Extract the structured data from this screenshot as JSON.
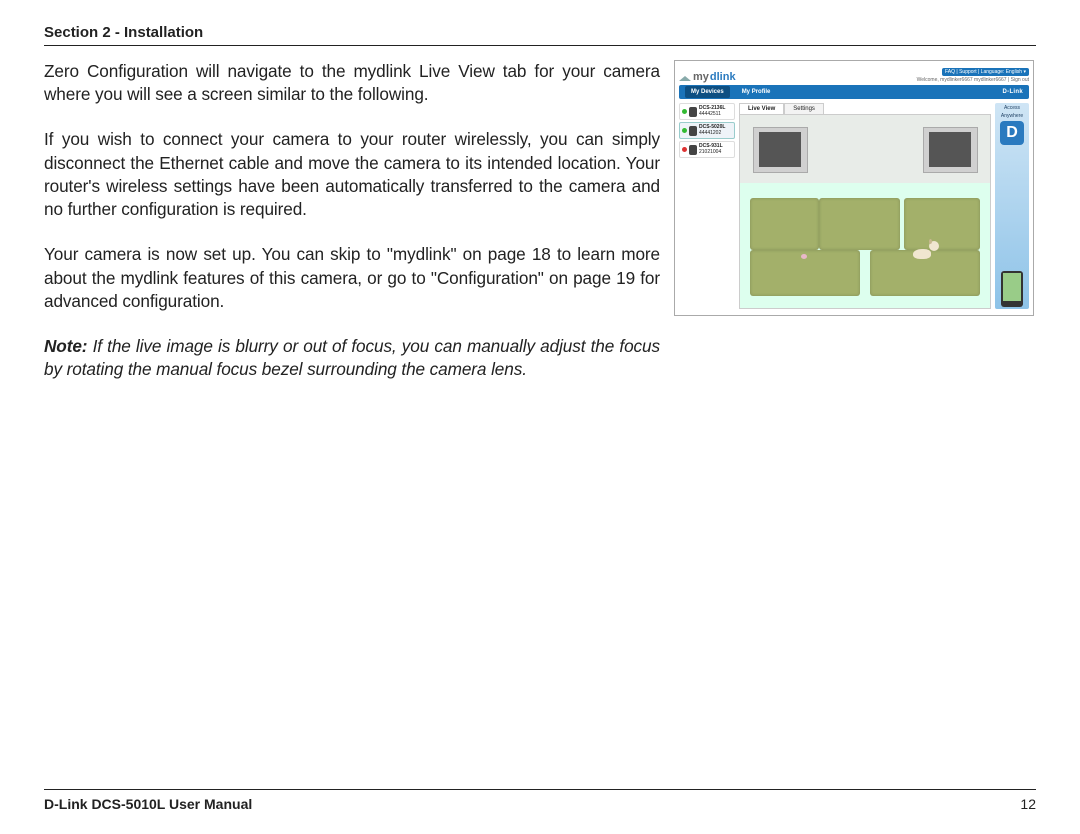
{
  "header": {
    "section": "Section 2 - Installation"
  },
  "body": {
    "p1": "Zero Configuration will navigate to the mydlink Live View tab for your camera where you will see a screen similar to the following.",
    "p2": "If you wish to connect your camera to your router wirelessly, you can simply disconnect the Ethernet cable and move the camera to its intended location. Your router's wireless settings have been automatically transferred to the camera and no further configuration is required.",
    "p3": "Your camera is now set up. You can skip to \"mydlink\" on page 18 to learn more about the mydlink features of this camera, or go to \"Configuration\" on page 19 for advanced configuration.",
    "note_label": "Note:",
    "note": " If the live image is blurry or out of focus, you can manually adjust the focus by rotating the manual focus bezel surrounding the camera lens."
  },
  "screenshot": {
    "logo_prefix": "my",
    "logo_suffix": "dlink",
    "faq": "FAQ | Support | Language: English ▾",
    "welcome": "Welcome, mydlinker6667 mydlinker6667 | Sign out",
    "nav": {
      "devices": "My Devices",
      "profile": "My Profile",
      "brand": "D-Link"
    },
    "devices": [
      {
        "name": "DCS-2136L",
        "id": "44442511",
        "online": true
      },
      {
        "name": "DCS-5020L",
        "id": "44441202",
        "online": true,
        "selected": true
      },
      {
        "name": "DCS-931L",
        "id": "21021004",
        "online": false
      }
    ],
    "tabs": {
      "live": "Live View",
      "settings": "Settings"
    },
    "ad": {
      "l1": "Access",
      "l2": "Anywhere",
      "d": "D"
    }
  },
  "footer": {
    "title": "D-Link DCS-5010L User Manual",
    "page": "12"
  }
}
